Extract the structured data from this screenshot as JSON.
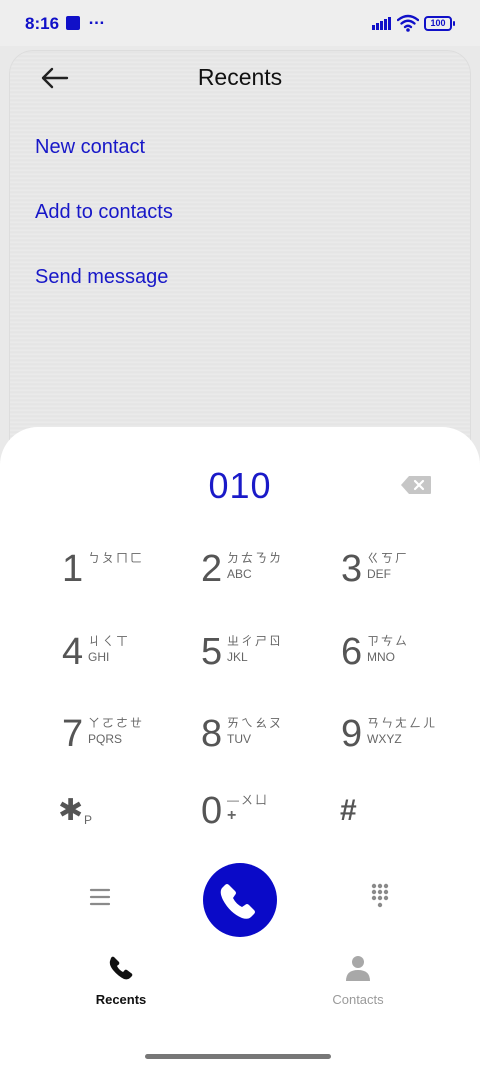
{
  "status_bar": {
    "time": "8:16",
    "dots": "…",
    "battery": "100"
  },
  "header": {
    "title": "Recents"
  },
  "menu": [
    {
      "label": "New contact"
    },
    {
      "label": "Add to contacts"
    },
    {
      "label": "Send message"
    }
  ],
  "dialer": {
    "number": "010",
    "keys": [
      {
        "digit": "1",
        "zhuyin": "ㄅㄆㄇㄈ",
        "letters": ""
      },
      {
        "digit": "2",
        "zhuyin": "ㄉㄊㄋㄌ",
        "letters": "ABC"
      },
      {
        "digit": "3",
        "zhuyin": "ㄍㄎㄏ",
        "letters": "DEF"
      },
      {
        "digit": "4",
        "zhuyin": "ㄐㄑㄒ",
        "letters": "GHI"
      },
      {
        "digit": "5",
        "zhuyin": "ㄓㄔㄕㄖ",
        "letters": "JKL"
      },
      {
        "digit": "6",
        "zhuyin": "ㄗㄘㄙ",
        "letters": "MNO"
      },
      {
        "digit": "7",
        "zhuyin": "ㄚㄛㄜㄝ",
        "letters": "PQRS"
      },
      {
        "digit": "8",
        "zhuyin": "ㄞㄟㄠㄡ",
        "letters": "TUV"
      },
      {
        "digit": "9",
        "zhuyin": "ㄢㄣㄤㄥㄦ",
        "letters": "WXYZ"
      },
      {
        "digit": "✱",
        "zhuyin": "",
        "letters": "P"
      },
      {
        "digit": "0",
        "zhuyin": "—ㄨㄩ",
        "letters": "+"
      },
      {
        "digit": "#",
        "zhuyin": "",
        "letters": ""
      }
    ]
  },
  "bottom_nav": [
    {
      "label": "Recents",
      "icon": "phone-icon",
      "active": true
    },
    {
      "label": "Contacts",
      "icon": "person-icon",
      "active": false
    }
  ],
  "colors": {
    "accent": "#0a0ac8",
    "text_active": "#111111",
    "text_inactive": "#9a9a9a"
  }
}
